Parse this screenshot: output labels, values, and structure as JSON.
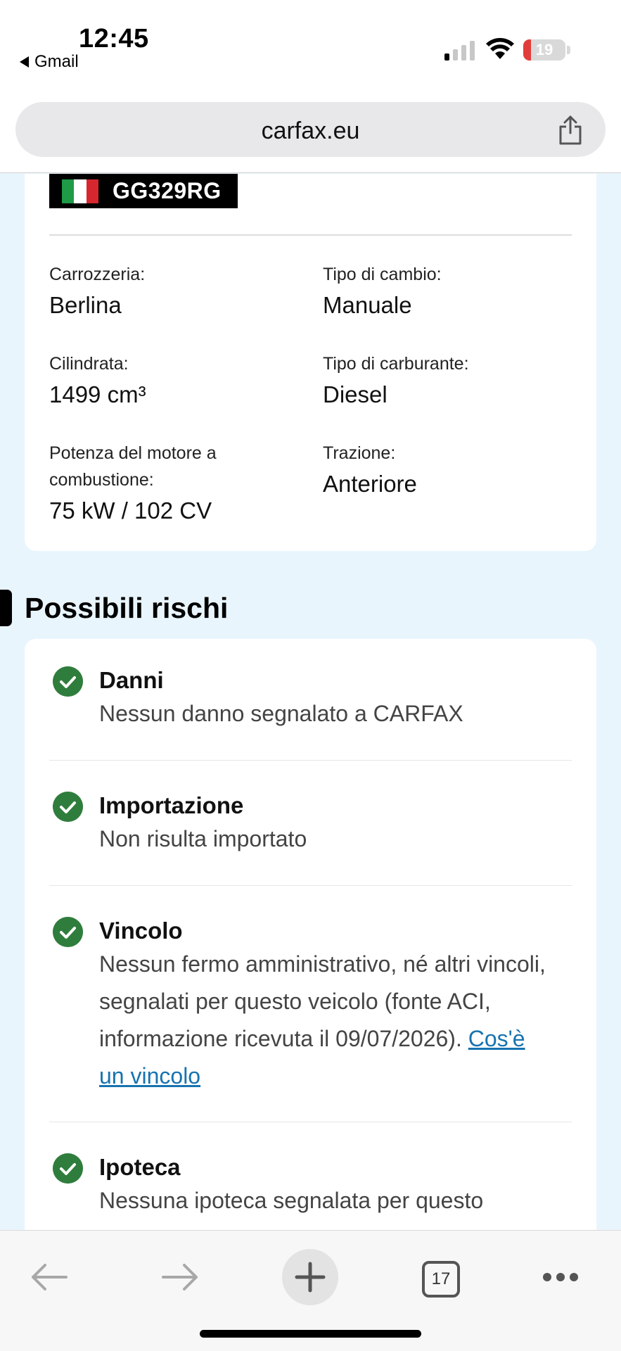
{
  "status_bar": {
    "time": "12:45",
    "back_app": "Gmail",
    "battery_level": "19",
    "battery_fraction": 0.19
  },
  "browser": {
    "url": "carfax.eu",
    "tabs_count": "17"
  },
  "vehicle": {
    "plate": "GG329RG",
    "specs": [
      {
        "label": "Carrozzeria:",
        "value": "Berlina"
      },
      {
        "label": "Tipo di cambio:",
        "value": "Manuale"
      },
      {
        "label": "Cilindrata:",
        "value": "1499 cm³"
      },
      {
        "label": "Tipo di carburante:",
        "value": "Diesel"
      },
      {
        "label": "Potenza del motore a combustione:",
        "value": "75 kW / 102 CV"
      },
      {
        "label": "Trazione:",
        "value": "Anteriore"
      }
    ]
  },
  "risks": {
    "title": "Possibili rischi",
    "items": [
      {
        "title": "Danni",
        "desc": "Nessun danno segnalato a CARFAX"
      },
      {
        "title": "Importazione",
        "desc": "Non risulta importato"
      },
      {
        "title": "Vincolo",
        "desc": "Nessun fermo amministrativo, né altri vincoli, segnalati per questo veicolo (fonte ACI, informazione ricevuta il 09/07/2026). ",
        "link": "Cos'è un vincolo"
      },
      {
        "title": "Ipoteca",
        "desc": "Nessuna ipoteca segnalata per questo"
      }
    ]
  },
  "colors": {
    "check_green": "#2f7d3c",
    "link_blue": "#1773b0",
    "page_bg": "#e9f5fd",
    "battery_red": "#e23c3a"
  },
  "icons": {
    "back": "arrow-left-icon",
    "forward": "arrow-right-icon",
    "new_tab": "plus-icon",
    "tabs": "tabs-icon",
    "more": "more-dots-icon",
    "share": "share-icon"
  }
}
